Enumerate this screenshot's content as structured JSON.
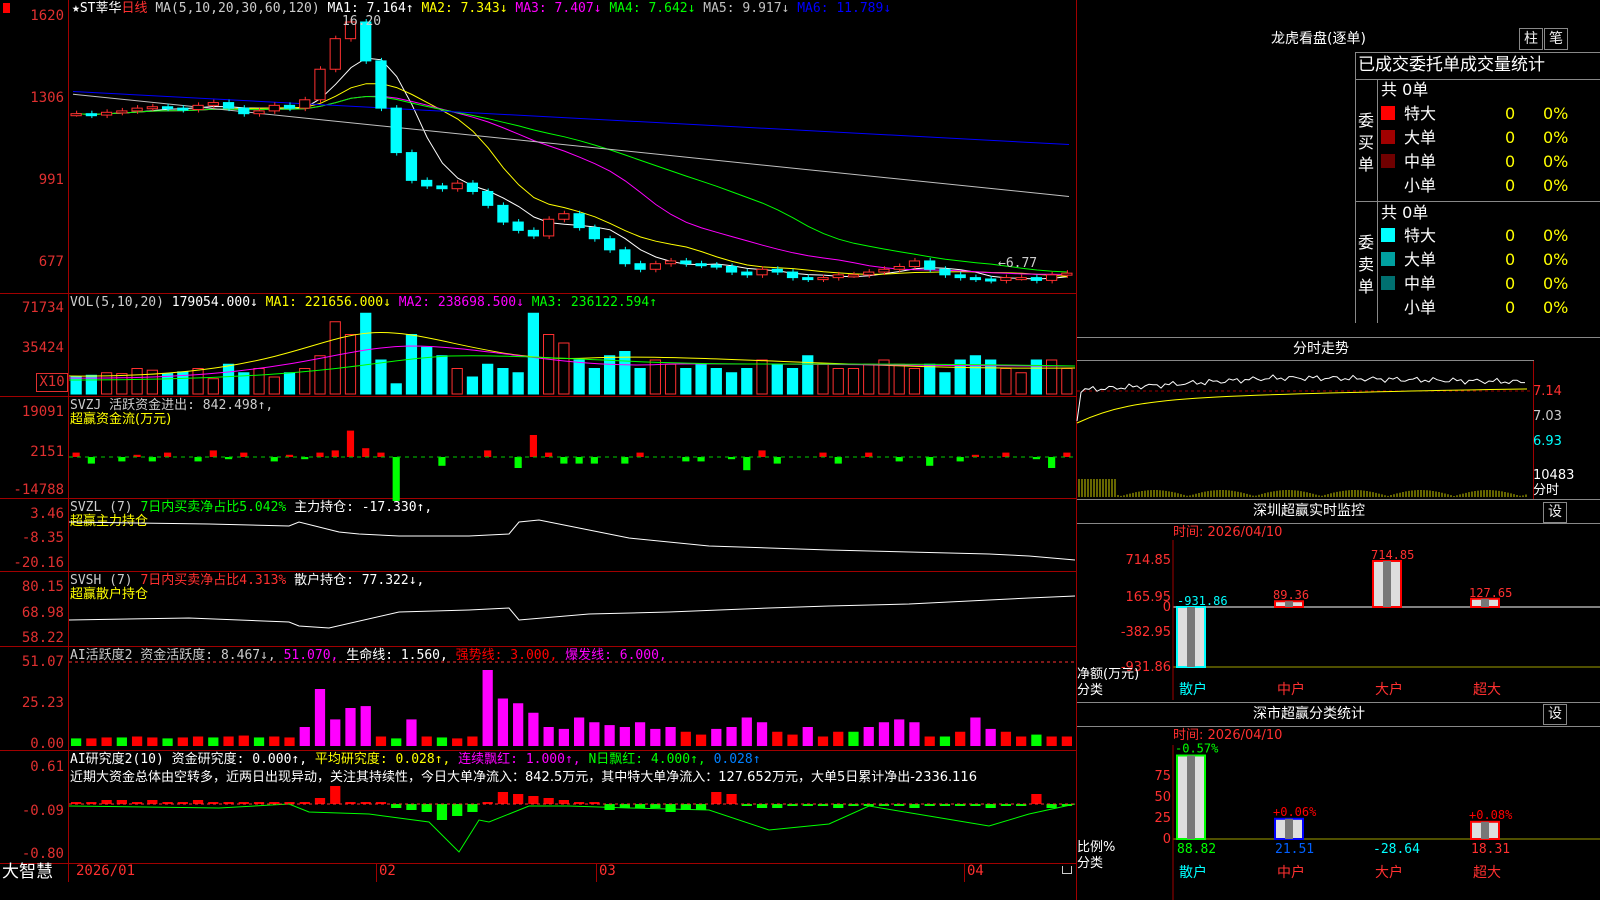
{
  "main": {
    "title_star": "★ST莘华",
    "period": "日线",
    "ma_label": "MA(5,10,20,30,60,120)",
    "ma_values": [
      {
        "name": "MA1:",
        "value": "7.164↑",
        "color": "#ffffff"
      },
      {
        "name": "MA2:",
        "value": "7.343↓",
        "color": "#ffff00"
      },
      {
        "name": "MA3:",
        "value": "7.407↓",
        "color": "#ff00ff"
      },
      {
        "name": "MA4:",
        "value": "7.642↓",
        "color": "#00ff00"
      },
      {
        "name": "MA5:",
        "value": "9.917↓",
        "color": "#c0c0c0"
      },
      {
        "name": "MA6:",
        "value": "11.789↓",
        "color": "#0000ff"
      }
    ],
    "y_ticks": [
      "1620",
      "1306",
      "991",
      "677"
    ],
    "high_label": "16.20",
    "low_label": "←6.77"
  },
  "vol": {
    "label": "VOL(5,10,20)",
    "v": "179054.000↓",
    "ma1": "MA1: 221656.000↓",
    "ma2": "MA2: 238698.500↓",
    "ma3": "MA3: 236122.594↑",
    "y_ticks": [
      "71734",
      "35424"
    ],
    "unit": "X10"
  },
  "svzj": {
    "label": "SVZJ  活跃资金进出: 842.498↑,",
    "sub": "超赢资金流(万元)",
    "y_ticks": [
      "19091",
      "2151",
      "-14788"
    ]
  },
  "svzl": {
    "label": "SVZL (7)",
    "ratio": "7日内买卖净占比5.042%",
    "hold": "主力持仓: -17.330↑,",
    "sub": "超赢主力持仓",
    "y_ticks": [
      "3.46",
      "-8.35",
      "-20.16"
    ]
  },
  "svsh": {
    "label": "SVSH (7)",
    "ratio": "7日内买卖净占比4.313%",
    "hold": "散户持仓: 77.322↓,",
    "sub": "超赢散户持仓",
    "y_ticks": [
      "80.15",
      "68.98",
      "58.22"
    ]
  },
  "ai1": {
    "label": "AI活跃度2 资金活跃度: 8.467↓,",
    "v2": "51.070,",
    "life": "生命线: 1.560,",
    "strong": "强势线: 3.000,",
    "burst": "爆发线: 6.000,",
    "y_ticks": [
      "51.07",
      "25.23",
      "0.00"
    ]
  },
  "ai2": {
    "label": "AI研究度2(10) 资金研究度: 0.000↑,",
    "avg": "平均研究度: 0.028↑,",
    "cont": "连续飘红: 1.000↑,",
    "nday": "N日飘红: 4.000↑,",
    "last": "0.028↑",
    "commentary": "近期大资金总体由空转多，近两日出现异动，关注其持续性，今日大单净流入：842.5万元，其中特大单净流入：127.652万元，大单5日累计净出-2336.116",
    "y_ticks": [
      "0.61",
      "-0.09",
      "-0.80"
    ]
  },
  "xaxis": {
    "brand": "大智慧",
    "labels": [
      "2026/01",
      "02",
      "03",
      "04"
    ]
  },
  "dragon": {
    "title": "龙虎看盘(逐单)",
    "btn1": "柱",
    "btn2": "笔",
    "tabs": "已成交委托单成交量统计",
    "buy_label": "委买单",
    "sell_label": "委卖单",
    "buy_total": "共 0单",
    "sell_total": "共 0单",
    "buy_rows": [
      {
        "name": "特大",
        "count": "0",
        "pct": "0%",
        "color": "#ff0000"
      },
      {
        "name": "大单",
        "count": "0",
        "pct": "0%",
        "color": "#a00000"
      },
      {
        "name": "中单",
        "count": "0",
        "pct": "0%",
        "color": "#700000"
      },
      {
        "name": "小单",
        "count": "0",
        "pct": "0%",
        "color": "#000000"
      }
    ],
    "sell_rows": [
      {
        "name": "特大",
        "count": "0",
        "pct": "0%",
        "color": "#00ffff"
      },
      {
        "name": "大单",
        "count": "0",
        "pct": "0%",
        "color": "#00a0a0"
      },
      {
        "name": "中单",
        "count": "0",
        "pct": "0%",
        "color": "#007070"
      },
      {
        "name": "小单",
        "count": "0",
        "pct": "0%",
        "color": "#000000"
      }
    ]
  },
  "intraday": {
    "title": "分时走势",
    "y_ticks": [
      "7.14",
      "7.03",
      "6.93"
    ],
    "vol_label": "10483",
    "vol_unit": "分时"
  },
  "sz_monitor": {
    "title": "深圳超赢实时监控",
    "set_btn": "设",
    "time": "时间: 2026/04/10",
    "y_ticks": [
      "714.85",
      "165.95",
      "0",
      "-382.95",
      "-931.86"
    ],
    "bars": [
      {
        "label": "散户",
        "value": "-931.86",
        "color": "#00ffff"
      },
      {
        "label": "中户",
        "value": "89.36",
        "color": "#ff0000"
      },
      {
        "label": "大户",
        "value": "714.85",
        "color": "#ff0000"
      },
      {
        "label": "超大",
        "value": "127.65",
        "color": "#ff0000"
      }
    ],
    "ylabel": "净额(万元)",
    "xlabel": "分类"
  },
  "sz_stats": {
    "title": "深市超赢分类统计",
    "set_btn": "设",
    "time": "时间: 2026/04/10",
    "y_ticks": [
      "75",
      "50",
      "25",
      "0"
    ],
    "ylabel": "比例%",
    "xlabel": "分类",
    "bars": [
      {
        "label": "散户",
        "value": "88.82",
        "change": "-0.57%",
        "bar_color": "#00ff00",
        "change_color": "#00ff00"
      },
      {
        "label": "中户",
        "value": "21.51",
        "change": "+0.06%",
        "bar_color": "#0000ff",
        "change_color": "#ff0000"
      },
      {
        "label": "大户",
        "value": "-28.64",
        "change": "",
        "bar_color": "#00ffff",
        "change_color": "#00ffff"
      },
      {
        "label": "超大",
        "value": "18.31",
        "change": "+0.08%",
        "bar_color": "#ff0000",
        "change_color": "#ff0000"
      }
    ]
  },
  "chart_data": {
    "type": "candlestick",
    "ylim": [
      6.77,
      16.2
    ],
    "x_labels": [
      "2026/01",
      "02",
      "03",
      "04"
    ],
    "close_sketch": [
      12.9,
      12.85,
      12.95,
      13.0,
      13.1,
      13.15,
      13.1,
      13.05,
      13.2,
      13.3,
      13.1,
      12.9,
      13.0,
      13.2,
      13.1,
      13.4,
      14.5,
      15.6,
      16.2,
      14.8,
      13.1,
      11.5,
      10.5,
      10.3,
      10.2,
      10.4,
      10.1,
      9.6,
      9.0,
      8.7,
      8.5,
      9.1,
      9.3,
      8.8,
      8.4,
      8.0,
      7.5,
      7.3,
      7.5,
      7.6,
      7.5,
      7.45,
      7.4,
      7.2,
      7.1,
      7.3,
      7.2,
      7.0,
      6.95,
      7.0,
      7.1,
      7.1,
      7.2,
      7.3,
      7.4,
      7.6,
      7.3,
      7.1,
      7.0,
      6.95,
      6.9,
      7.0,
      7.0,
      6.9,
      7.1,
      7.16
    ]
  }
}
